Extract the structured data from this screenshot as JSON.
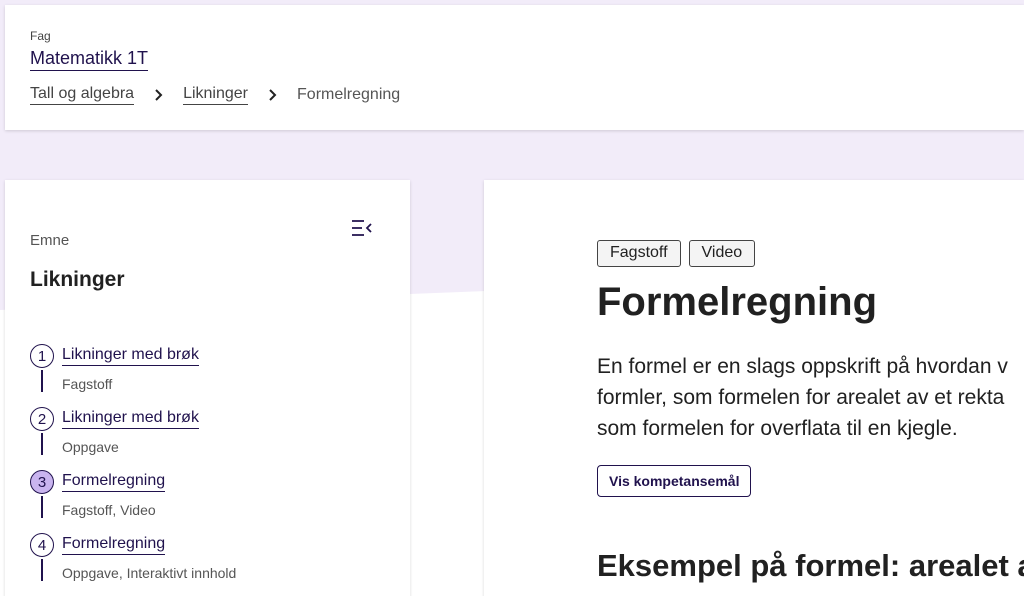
{
  "header": {
    "subject_label": "Fag",
    "subject_name": "Matematikk 1T",
    "breadcrumbs": [
      {
        "label": "Tall og algebra"
      },
      {
        "label": "Likninger"
      }
    ],
    "current": "Formelregning"
  },
  "sidebar": {
    "topic_label": "Emne",
    "topic_title": "Likninger",
    "menu_icon": "collapse-menu-icon",
    "items": [
      {
        "num": "1",
        "label": "Likninger med brøk",
        "meta": "Fagstoff"
      },
      {
        "num": "2",
        "label": "Likninger med brøk",
        "meta": "Oppgave"
      },
      {
        "num": "3",
        "label": "Formelregning",
        "meta": "Fagstoff, Video",
        "active": true
      },
      {
        "num": "4",
        "label": "Formelregning",
        "meta": "Oppgave, Interaktivt innhold"
      }
    ]
  },
  "main": {
    "tags": [
      "Fagstoff",
      "Video"
    ],
    "title": "Formelregning",
    "intro_lines": [
      "En formel er en slags oppskrift på hvordan v",
      "formler, som formelen for arealet av et rekta",
      "som formelen for overflata til en kjegle."
    ],
    "competence_button": "Vis kompetansemål",
    "section_heading": "Eksempel på formel: arealet av"
  },
  "colors": {
    "brand_dark": "#20124d",
    "page_bg": "#f2ecf9",
    "active_step": "#c9b4ef"
  }
}
